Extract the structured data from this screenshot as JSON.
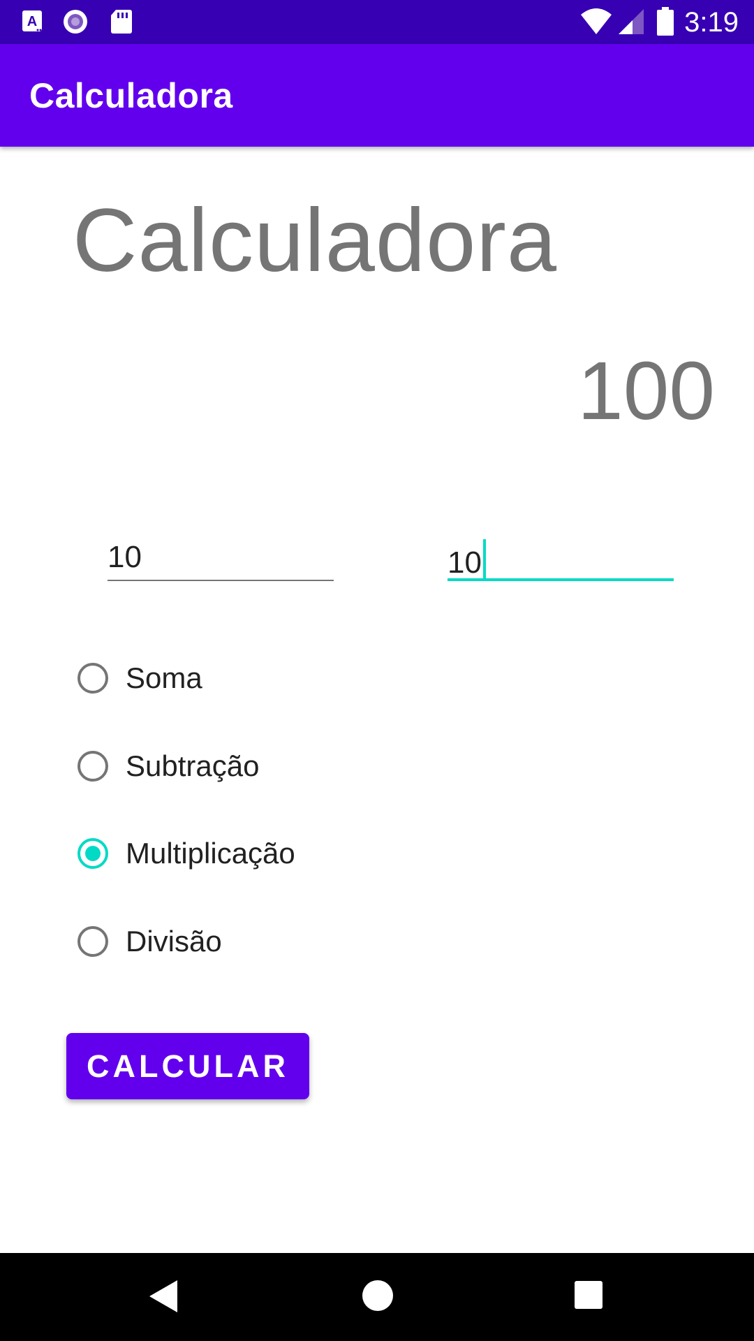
{
  "status_bar": {
    "time": "3:19",
    "icons_left": [
      "accessibility-icon",
      "record-icon",
      "sd-card-icon"
    ],
    "icons_right": [
      "wifi-icon",
      "signal-icon",
      "battery-icon"
    ]
  },
  "app_bar": {
    "title": "Calculadora"
  },
  "main": {
    "heading": "Calculadora",
    "result": "100",
    "inputs": [
      {
        "value": "10",
        "focused": false
      },
      {
        "value": "10",
        "focused": true
      }
    ],
    "operations": [
      {
        "label": "Soma",
        "checked": false
      },
      {
        "label": "Subtração",
        "checked": false
      },
      {
        "label": "Multiplicação",
        "checked": true
      },
      {
        "label": "Divisão",
        "checked": false
      }
    ],
    "button_label": "CALCULAR"
  },
  "nav_bar": {
    "buttons": [
      "back-icon",
      "home-icon",
      "recents-icon"
    ]
  },
  "colors": {
    "status_bar": "#3700b3",
    "primary": "#6200ee",
    "accent": "#03dac5",
    "text_secondary": "#757575"
  }
}
